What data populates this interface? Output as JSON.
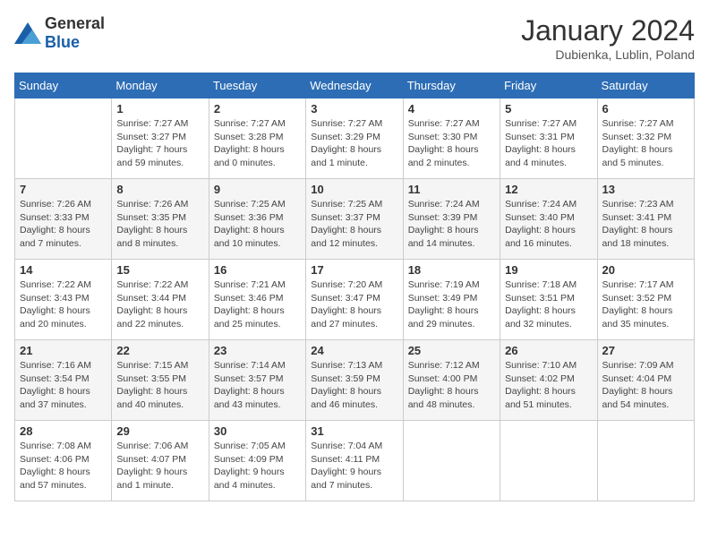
{
  "header": {
    "logo_general": "General",
    "logo_blue": "Blue",
    "month": "January 2024",
    "location": "Dubienka, Lublin, Poland"
  },
  "weekdays": [
    "Sunday",
    "Monday",
    "Tuesday",
    "Wednesday",
    "Thursday",
    "Friday",
    "Saturday"
  ],
  "weeks": [
    [
      {
        "day": "",
        "info": ""
      },
      {
        "day": "1",
        "info": "Sunrise: 7:27 AM\nSunset: 3:27 PM\nDaylight: 7 hours\nand 59 minutes."
      },
      {
        "day": "2",
        "info": "Sunrise: 7:27 AM\nSunset: 3:28 PM\nDaylight: 8 hours\nand 0 minutes."
      },
      {
        "day": "3",
        "info": "Sunrise: 7:27 AM\nSunset: 3:29 PM\nDaylight: 8 hours\nand 1 minute."
      },
      {
        "day": "4",
        "info": "Sunrise: 7:27 AM\nSunset: 3:30 PM\nDaylight: 8 hours\nand 2 minutes."
      },
      {
        "day": "5",
        "info": "Sunrise: 7:27 AM\nSunset: 3:31 PM\nDaylight: 8 hours\nand 4 minutes."
      },
      {
        "day": "6",
        "info": "Sunrise: 7:27 AM\nSunset: 3:32 PM\nDaylight: 8 hours\nand 5 minutes."
      }
    ],
    [
      {
        "day": "7",
        "info": "Sunrise: 7:26 AM\nSunset: 3:33 PM\nDaylight: 8 hours\nand 7 minutes."
      },
      {
        "day": "8",
        "info": "Sunrise: 7:26 AM\nSunset: 3:35 PM\nDaylight: 8 hours\nand 8 minutes."
      },
      {
        "day": "9",
        "info": "Sunrise: 7:25 AM\nSunset: 3:36 PM\nDaylight: 8 hours\nand 10 minutes."
      },
      {
        "day": "10",
        "info": "Sunrise: 7:25 AM\nSunset: 3:37 PM\nDaylight: 8 hours\nand 12 minutes."
      },
      {
        "day": "11",
        "info": "Sunrise: 7:24 AM\nSunset: 3:39 PM\nDaylight: 8 hours\nand 14 minutes."
      },
      {
        "day": "12",
        "info": "Sunrise: 7:24 AM\nSunset: 3:40 PM\nDaylight: 8 hours\nand 16 minutes."
      },
      {
        "day": "13",
        "info": "Sunrise: 7:23 AM\nSunset: 3:41 PM\nDaylight: 8 hours\nand 18 minutes."
      }
    ],
    [
      {
        "day": "14",
        "info": "Sunrise: 7:22 AM\nSunset: 3:43 PM\nDaylight: 8 hours\nand 20 minutes."
      },
      {
        "day": "15",
        "info": "Sunrise: 7:22 AM\nSunset: 3:44 PM\nDaylight: 8 hours\nand 22 minutes."
      },
      {
        "day": "16",
        "info": "Sunrise: 7:21 AM\nSunset: 3:46 PM\nDaylight: 8 hours\nand 25 minutes."
      },
      {
        "day": "17",
        "info": "Sunrise: 7:20 AM\nSunset: 3:47 PM\nDaylight: 8 hours\nand 27 minutes."
      },
      {
        "day": "18",
        "info": "Sunrise: 7:19 AM\nSunset: 3:49 PM\nDaylight: 8 hours\nand 29 minutes."
      },
      {
        "day": "19",
        "info": "Sunrise: 7:18 AM\nSunset: 3:51 PM\nDaylight: 8 hours\nand 32 minutes."
      },
      {
        "day": "20",
        "info": "Sunrise: 7:17 AM\nSunset: 3:52 PM\nDaylight: 8 hours\nand 35 minutes."
      }
    ],
    [
      {
        "day": "21",
        "info": "Sunrise: 7:16 AM\nSunset: 3:54 PM\nDaylight: 8 hours\nand 37 minutes."
      },
      {
        "day": "22",
        "info": "Sunrise: 7:15 AM\nSunset: 3:55 PM\nDaylight: 8 hours\nand 40 minutes."
      },
      {
        "day": "23",
        "info": "Sunrise: 7:14 AM\nSunset: 3:57 PM\nDaylight: 8 hours\nand 43 minutes."
      },
      {
        "day": "24",
        "info": "Sunrise: 7:13 AM\nSunset: 3:59 PM\nDaylight: 8 hours\nand 46 minutes."
      },
      {
        "day": "25",
        "info": "Sunrise: 7:12 AM\nSunset: 4:00 PM\nDaylight: 8 hours\nand 48 minutes."
      },
      {
        "day": "26",
        "info": "Sunrise: 7:10 AM\nSunset: 4:02 PM\nDaylight: 8 hours\nand 51 minutes."
      },
      {
        "day": "27",
        "info": "Sunrise: 7:09 AM\nSunset: 4:04 PM\nDaylight: 8 hours\nand 54 minutes."
      }
    ],
    [
      {
        "day": "28",
        "info": "Sunrise: 7:08 AM\nSunset: 4:06 PM\nDaylight: 8 hours\nand 57 minutes."
      },
      {
        "day": "29",
        "info": "Sunrise: 7:06 AM\nSunset: 4:07 PM\nDaylight: 9 hours\nand 1 minute."
      },
      {
        "day": "30",
        "info": "Sunrise: 7:05 AM\nSunset: 4:09 PM\nDaylight: 9 hours\nand 4 minutes."
      },
      {
        "day": "31",
        "info": "Sunrise: 7:04 AM\nSunset: 4:11 PM\nDaylight: 9 hours\nand 7 minutes."
      },
      {
        "day": "",
        "info": ""
      },
      {
        "day": "",
        "info": ""
      },
      {
        "day": "",
        "info": ""
      }
    ]
  ]
}
